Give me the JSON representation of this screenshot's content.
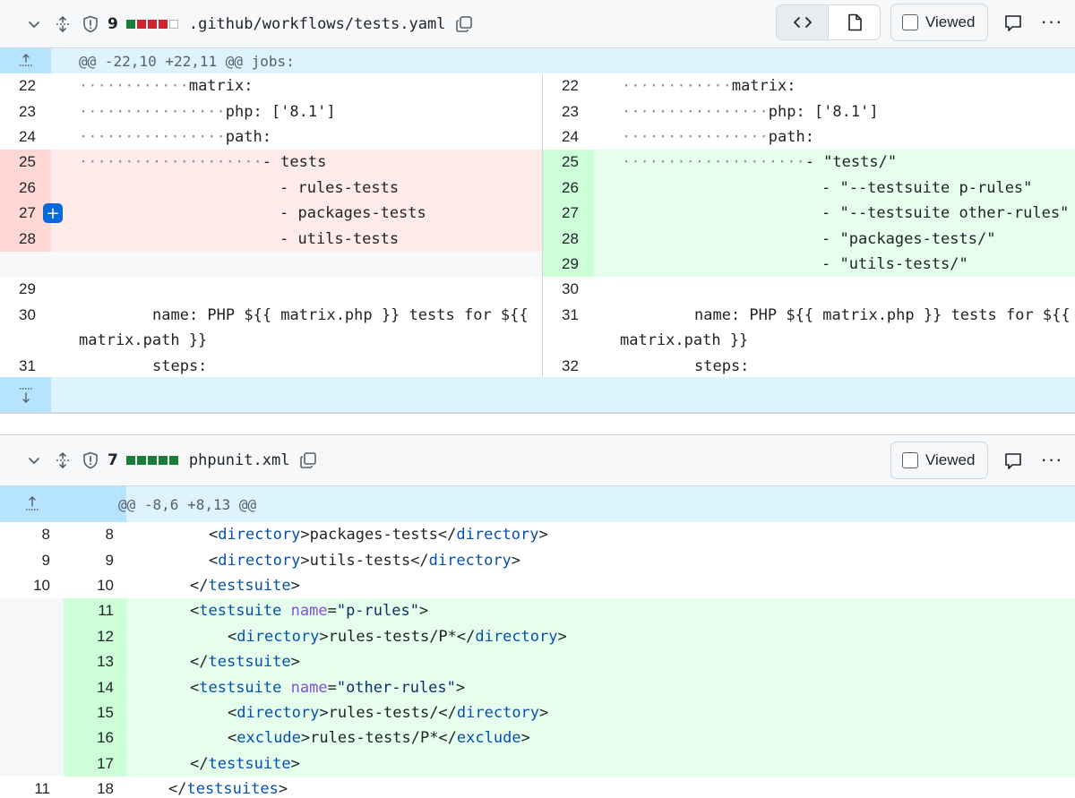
{
  "file1": {
    "count": "9",
    "filename": ".github/workflows/tests.yaml",
    "viewed_label": "Viewed",
    "hunk_header": "@@ -22,10 +22,11 @@ jobs:",
    "left": {
      "lines": [
        {
          "n": "22",
          "text": "matrix:",
          "dots": "············"
        },
        {
          "n": "23",
          "text": "php: ['8.1']",
          "dots": "················"
        },
        {
          "n": "24",
          "text": "path:",
          "dots": "················"
        },
        {
          "n": "25",
          "text": "- tests",
          "dots": "····················"
        },
        {
          "n": "26",
          "text": "- rules-tests"
        },
        {
          "n": "27",
          "text": "- packages-tests"
        },
        {
          "n": "28",
          "text": "- utils-tests"
        },
        {
          "n": "29",
          "text": ""
        },
        {
          "n": "30",
          "text": "name: PHP ${{ matrix.php }} tests for ${{"
        },
        {
          "n": "",
          "text": "matrix.path }}"
        },
        {
          "n": "31",
          "text": "steps:"
        }
      ]
    },
    "right": {
      "lines": [
        {
          "n": "22",
          "text": "matrix:",
          "dots": "············"
        },
        {
          "n": "23",
          "text": "php: ['8.1']",
          "dots": "················"
        },
        {
          "n": "24",
          "text": "path:",
          "dots": "················"
        },
        {
          "n": "25",
          "text": "- \"tests/\"",
          "dots": "····················"
        },
        {
          "n": "26",
          "text": "- \"--testsuite p-rules\""
        },
        {
          "n": "27",
          "text": "- \"--testsuite other-rules\""
        },
        {
          "n": "28",
          "text": "- \"packages-tests/\""
        },
        {
          "n": "29",
          "text": "- \"utils-tests/\""
        },
        {
          "n": "30",
          "text": ""
        },
        {
          "n": "31",
          "text": "name: PHP ${{ matrix.php }} tests for ${{"
        },
        {
          "n": "",
          "text": "matrix.path }}"
        },
        {
          "n": "32",
          "text": "steps:"
        }
      ]
    }
  },
  "file2": {
    "count": "7",
    "filename": "phpunit.xml",
    "viewed_label": "Viewed",
    "hunk_header": "@@ -8,6 +8,13 @@",
    "lines": [
      {
        "old": "8",
        "new": "8",
        "text": "<directory>packages-tests</directory>"
      },
      {
        "old": "9",
        "new": "9",
        "text": "<directory>utils-tests</directory>"
      },
      {
        "old": "10",
        "new": "10",
        "text": "</testsuite>"
      },
      {
        "old": "",
        "new": "11",
        "text": "<testsuite name=\"p-rules\">"
      },
      {
        "old": "",
        "new": "12",
        "text": "<directory>rules-tests/P*</directory>"
      },
      {
        "old": "",
        "new": "13",
        "text": "</testsuite>"
      },
      {
        "old": "",
        "new": "14",
        "text": "<testsuite name=\"other-rules\">"
      },
      {
        "old": "",
        "new": "15",
        "text": "<directory>rules-tests/</directory>"
      },
      {
        "old": "",
        "new": "16",
        "text": "<exclude>rules-tests/P*</exclude>"
      },
      {
        "old": "",
        "new": "17",
        "text": "</testsuite>"
      },
      {
        "old": "11",
        "new": "18",
        "text": "</testsuites>"
      }
    ]
  },
  "colors": {
    "addition": "#e6ffec",
    "deletion": "#ffebe9",
    "hunk": "#ddf4ff",
    "accent": "#0969da"
  }
}
